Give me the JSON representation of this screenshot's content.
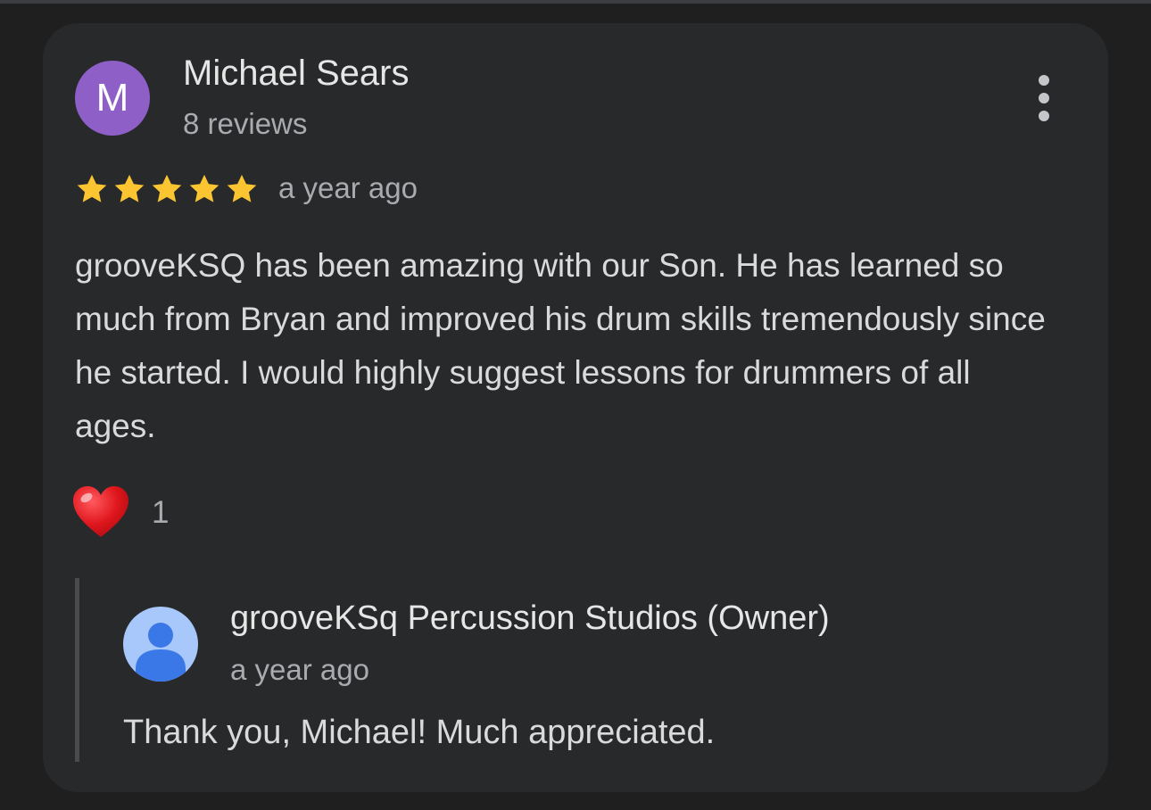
{
  "review": {
    "reviewer": {
      "initial": "M",
      "name": "Michael Sears",
      "meta": "8 reviews",
      "avatar_color": "#8e5fc6"
    },
    "rating": 5,
    "rating_max": 5,
    "star_color": "#fbc531",
    "time_ago": "a year ago",
    "text": "grooveKSQ has been amazing with our Son. He has learned so much from Bryan and improved his drum skills tremendously since he started. I would highly suggest lessons for drummers of all ages.",
    "reaction": {
      "icon": "heart-icon",
      "count": "1"
    },
    "more_icon": "more-vert-icon"
  },
  "owner_response": {
    "name": "grooveKSq Percussion Studios (Owner)",
    "time_ago": "a year ago",
    "text": "Thank you, Michael! Much appreciated.",
    "avatar_icon": "person-icon",
    "avatar_bg": "#a8c7fa",
    "avatar_fg": "#3b78e7"
  }
}
